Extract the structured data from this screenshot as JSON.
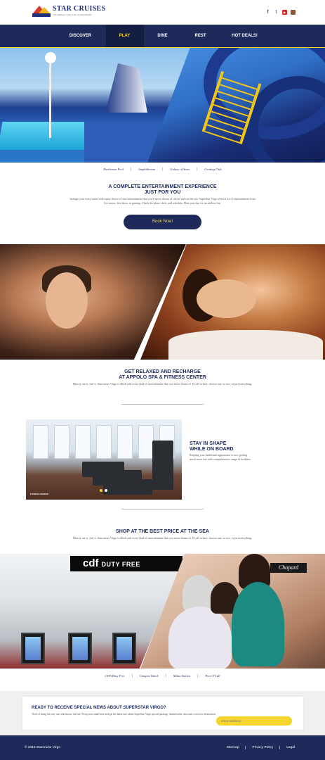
{
  "header": {
    "brand_name": "STAR CRUISES",
    "tagline": "The leading Cruise Line in Asia-Pacific"
  },
  "social": [
    {
      "name": "facebook-icon",
      "glyph": "f"
    },
    {
      "name": "twitter-icon",
      "glyph": "t"
    },
    {
      "name": "youtube-icon",
      "glyph": "▶"
    },
    {
      "name": "instagram-icon",
      "glyph": ""
    }
  ],
  "nav": {
    "items": [
      {
        "label": "DISCOVER"
      },
      {
        "label": "PLAY",
        "active": true
      },
      {
        "label": "DINE"
      },
      {
        "label": "REST"
      },
      {
        "label": "HOT DEALS!"
      }
    ]
  },
  "hero_links": [
    "Parthenon Pool",
    "Amphitheatre",
    "Galaxy of Stars",
    "Genting Club"
  ],
  "entertainment": {
    "title_line1": "A COMPLETE ENTERTAINMENT EXPERIENCE",
    "title_line2": "JUST FOR YOU",
    "body": "Indulge your every sense with many choice of star entertainment that you'll never dream of can be seen on the sea. SuperStar Virgo offers a lot of entertainment from live music, live show, to gaming. Check the plans, deck, and schedule. Plan your day for an endless fun.",
    "button": "Book Now!"
  },
  "spa": {
    "title_line1": "GET RELAXED AND RECHARGE",
    "title_line2": "AT APPOLO SPA & FITNESS CENTER",
    "body": "Hear it, see it, feel it. Starcruises Virgo is filled with every kind of entertainment that you never dream of. It's all in here, choose one, or two, or just everything."
  },
  "fitness": {
    "image_label": "FITNESS CENTER",
    "title_line1": "STAY IN SHAPE",
    "title_line2": "WHILE ON BOARD",
    "body": "Keeping your health and appearance is now getting much more fun with comprehensive range of facilities.",
    "dots": [
      true,
      false
    ]
  },
  "shop": {
    "title": "SHOP AT THE BEST PRICE AT THE SEA",
    "body": "Hear it, see it, feel it. Starcruises Virgo is filled with every kind of entertainment that you never dream of. It's all in here, choose one, or two, or just everything.",
    "sign_main": "cdf",
    "sign_sub": "DUTY FREE",
    "brand_sign": "Chopard"
  },
  "shop_links": [
    "CFD Duty Free",
    "Campus Watch",
    "Milan Station",
    "Port O'Call"
  ],
  "newsletter": {
    "title": "READY TO RECEIVE SPECIAL NEWS ABOUT SUPERSTAR VIRGO?",
    "body": "Tired of being the only one who knows the last? Drop your email here and get the latest info about SuperStar Virgo special package, limited offer, discount, even new destination.",
    "placeholder": "email address"
  },
  "footer": {
    "copyright": "© 2015 Starcruise Virgo",
    "links": [
      "Sitemap",
      "Privacy Policy",
      "Legal"
    ]
  },
  "colors": {
    "navy": "#1d2a5a",
    "accent_yellow": "#f5d52e"
  }
}
